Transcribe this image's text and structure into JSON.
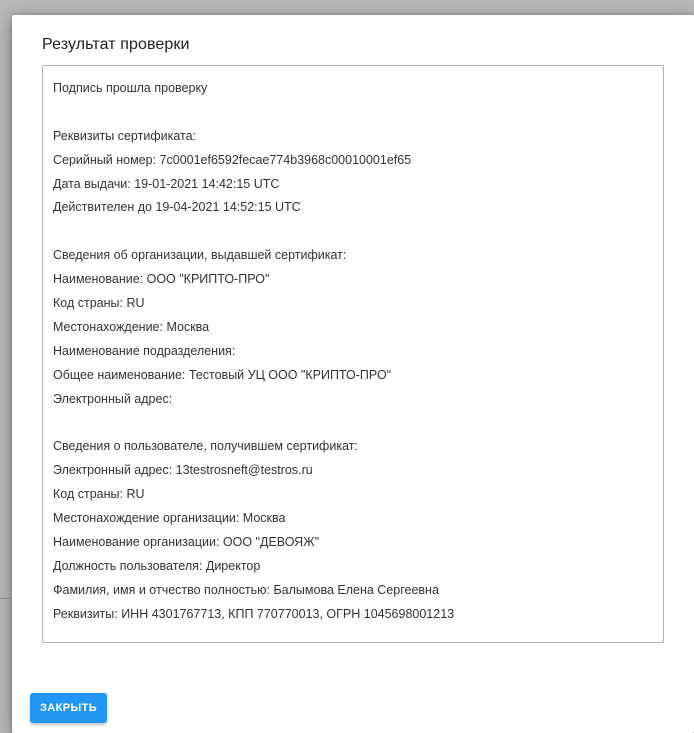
{
  "dialog": {
    "title": "Результат проверки",
    "close_label": "ЗАКРЫТЬ",
    "result_lines": [
      "Подпись прошла проверку",
      "",
      "Реквизиты сертификата:",
      "Серийный номер: 7c0001ef6592fecae774b3968c00010001ef65",
      "Дата выдачи: 19-01-2021 14:42:15 UTC",
      "Действителен до 19-04-2021 14:52:15 UTC",
      "",
      "Сведения об организации, выдавшей сертификат:",
      "Наименование: ООО \"КРИПТО-ПРО\"",
      "Код страны: RU",
      "Местонахождение: Москва",
      "Наименование подразделения:",
      "Общее наименование: Тестовый УЦ ООО \"КРИПТО-ПРО\"",
      "Электронный адрес:",
      "",
      "Сведения о пользователе, получившем сертификат:",
      "Электронный адрес: 13testrosneft@testros.ru",
      "Код страны: RU",
      "Местонахождение организации: Москва",
      "Наименование организации: ООО \"ДЕВОЯЖ\"",
      "Должность пользователя: Директор",
      "Фамилия, имя и отчество полностью: Балымова Елена Сергеевна",
      "Реквизиты: ИНН 4301767713, КПП 770770013, ОГРН 1045698001213"
    ]
  },
  "colors": {
    "accent": "#2196f3",
    "backdrop": "#9e9e9e",
    "text": "#333333"
  }
}
